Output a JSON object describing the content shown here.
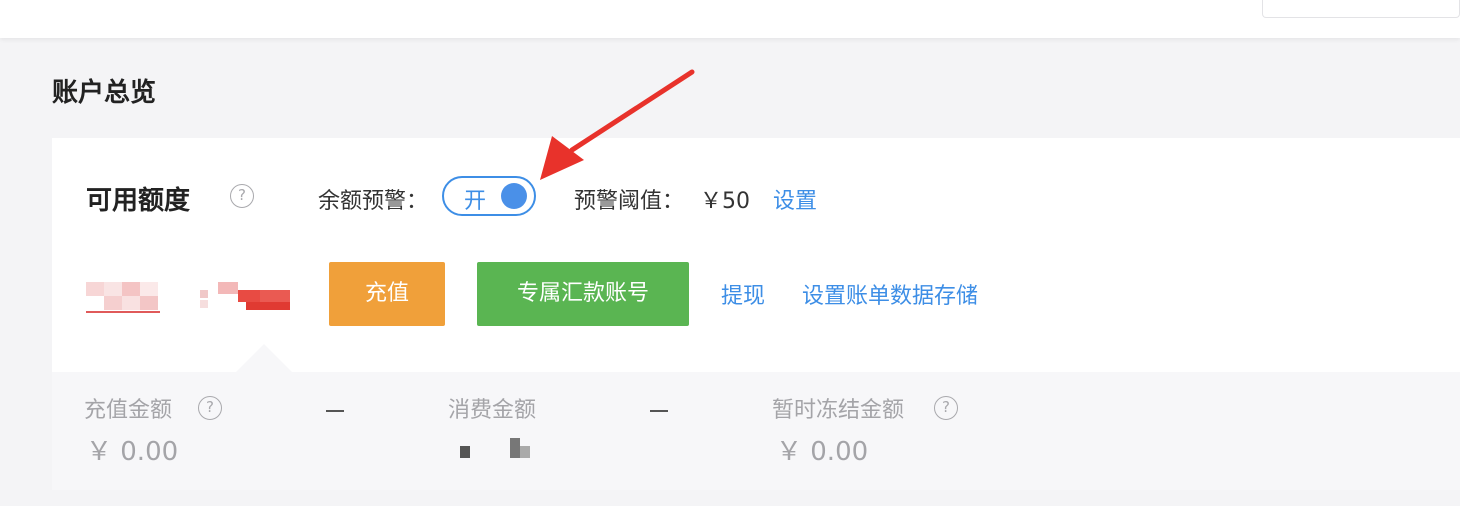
{
  "page": {
    "title": "账户总览"
  },
  "credit": {
    "title": "可用额度",
    "help_icon": "question-circle-icon",
    "balance_alert_label": "余额预警：",
    "toggle_state_label": "开",
    "toggle_on": true,
    "threshold_label": "预警阈值：",
    "threshold_value": "￥50",
    "set_link": "设置"
  },
  "actions": {
    "recharge_button": "充值",
    "dedicated_account_button": "专属汇款账号",
    "withdraw_link": "提现",
    "bill_storage_link": "设置账单数据存储"
  },
  "stats": {
    "recharge_amount_label": "充值金额",
    "recharge_amount_value": "￥ 0.00",
    "consumption_amount_label": "消费金额",
    "frozen_amount_label": "暂时冻结金额",
    "frozen_amount_value": "￥ 0.00"
  },
  "colors": {
    "accent_blue": "#3d8ee6",
    "recharge_orange": "#f0a03a",
    "account_green": "#5ab552",
    "annotation_red": "#e8322b"
  }
}
